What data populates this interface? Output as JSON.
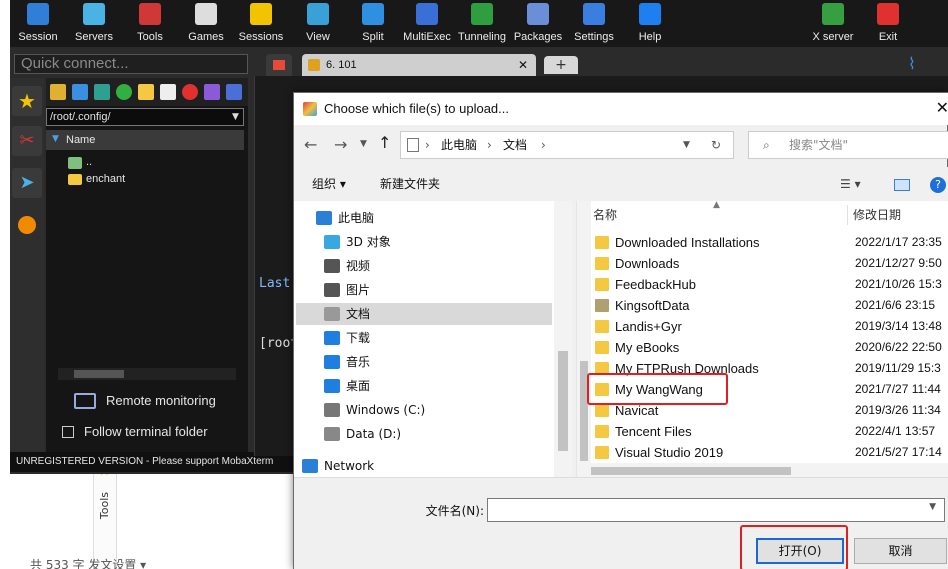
{
  "toolbar": [
    {
      "label": "Session",
      "color": "#2f7fd8"
    },
    {
      "label": "Servers",
      "color": "#4ab3e6"
    },
    {
      "label": "Tools",
      "color": "#d03838"
    },
    {
      "label": "Games",
      "color": "#dddddd"
    },
    {
      "label": "Sessions",
      "color": "#f2c300"
    },
    {
      "label": "View",
      "color": "#3aa0d8"
    },
    {
      "label": "Split",
      "color": "#2f8fe0"
    },
    {
      "label": "MultiExec",
      "color": "#3a6fd8"
    },
    {
      "label": "Tunneling",
      "color": "#2e9e3e"
    },
    {
      "label": "Packages",
      "color": "#6a8fd8"
    },
    {
      "label": "Settings",
      "color": "#3a7fe0"
    },
    {
      "label": "Help",
      "color": "#1e80f0"
    },
    {
      "label": "X server",
      "color": "#36a040"
    },
    {
      "label": "Exit",
      "color": "#e03030"
    }
  ],
  "quick_connect_placeholder": "Quick connect...",
  "side_panel": {
    "path": "/root/.config/",
    "column_name": "Name",
    "items": [
      "..",
      "enchant"
    ],
    "remote_monitoring": "Remote monitoring",
    "follow_terminal": "Follow terminal folder"
  },
  "tabs": {
    "term_tab": "6. 101"
  },
  "terminal": {
    "line1": "Last",
    "line2": "[root"
  },
  "unregistered": "UNREGISTERED VERSION  -  Please support MobaXterm",
  "background": {
    "tools_label": "Tools",
    "bottom_text": "共 533 字    发文设置 ▾"
  },
  "dialog": {
    "title": "Choose which file(s) to upload...",
    "breadcrumb": [
      "此电脑",
      "文档"
    ],
    "search_placeholder": "搜索\"文档\"",
    "organize": "组织 ▾",
    "new_folder": "新建文件夹",
    "nav_items": [
      {
        "label": "此电脑",
        "color": "#2a7fd6"
      },
      {
        "label": "3D 对象",
        "color": "#37a9e0"
      },
      {
        "label": "视频",
        "color": "#555555"
      },
      {
        "label": "图片",
        "color": "#555555"
      },
      {
        "label": "文档",
        "color": "#777777"
      },
      {
        "label": "下载",
        "color": "#1e7fe0"
      },
      {
        "label": "音乐",
        "color": "#1e7fe0"
      },
      {
        "label": "桌面",
        "color": "#1e7fe0"
      },
      {
        "label": "Windows (C:)",
        "color": "#777777"
      },
      {
        "label": "Data (D:)",
        "color": "#888888"
      },
      {
        "label": "Network",
        "color": "#2a7fd6"
      }
    ],
    "col_name": "名称",
    "col_date": "修改日期",
    "files": [
      {
        "name": "Downloaded Installations",
        "date": "2022/1/17 23:35"
      },
      {
        "name": "Downloads",
        "date": "2021/12/27 9:50"
      },
      {
        "name": "FeedbackHub",
        "date": "2021/10/26 15:3"
      },
      {
        "name": "KingsoftData",
        "date": "2021/6/6 23:15"
      },
      {
        "name": "Landis+Gyr",
        "date": "2019/3/14 13:48"
      },
      {
        "name": "My eBooks",
        "date": "2020/6/22 22:50"
      },
      {
        "name": "My FTPRush Downloads",
        "date": "2019/11/29 15:3"
      },
      {
        "name": "My WangWang",
        "date": "2021/7/27 11:44"
      },
      {
        "name": "Navicat",
        "date": "2019/3/26 11:34"
      },
      {
        "name": "Tencent Files",
        "date": "2022/4/1 13:57"
      },
      {
        "name": "Visual Studio 2019",
        "date": "2021/5/27 17:14"
      }
    ],
    "filename_label": "文件名(N):",
    "filename_value": "",
    "open_button": "打开(O)",
    "cancel_button": "取消"
  }
}
